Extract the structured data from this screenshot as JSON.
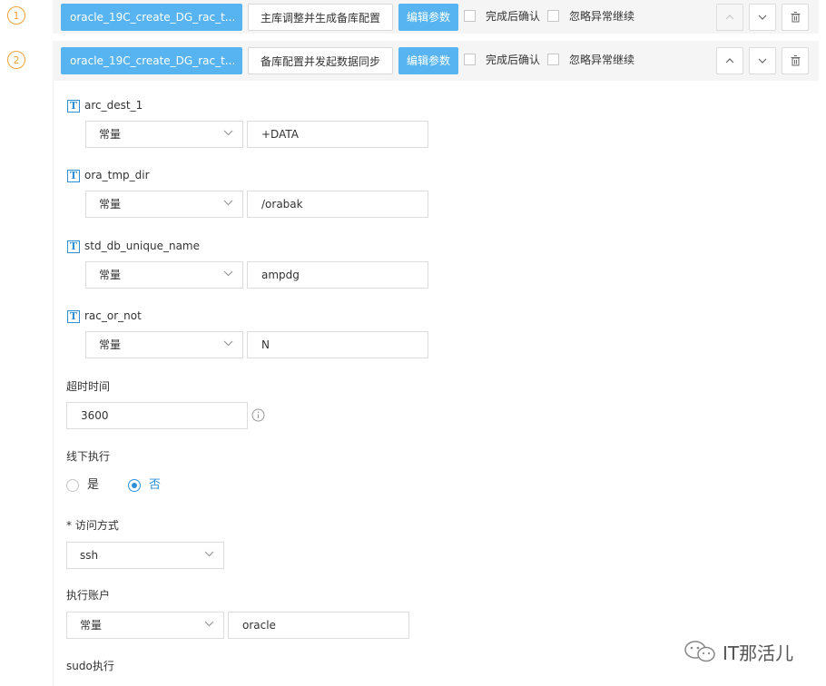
{
  "steps": [
    {
      "number": "1",
      "name": "oracle_19C_create_DG_rac_t...",
      "title": "主库调整并生成备库配置",
      "edit_label": "编辑参数",
      "confirm_label": "完成后确认",
      "ignore_label": "忽略异常继续"
    },
    {
      "number": "2",
      "name": "oracle_19C_create_DG_rac_t...",
      "title": "备库配置并发起数据同步",
      "edit_label": "编辑参数",
      "confirm_label": "完成后确认",
      "ignore_label": "忽略异常继续"
    }
  ],
  "icons": {
    "up": "chevron-up-icon",
    "down": "chevron-down-icon",
    "delete": "trash-icon",
    "param": "text-param-icon",
    "info": "info-icon"
  },
  "params": [
    {
      "name": "arc_dest_1",
      "type": "常量",
      "value": "+DATA"
    },
    {
      "name": "ora_tmp_dir",
      "type": "常量",
      "value": "/orabak"
    },
    {
      "name": "std_db_unique_name",
      "type": "常量",
      "value": "ampdg"
    },
    {
      "name": "rac_or_not",
      "type": "常量",
      "value": "N"
    }
  ],
  "timeout": {
    "label": "超时时间",
    "value": "3600"
  },
  "offline": {
    "label": "线下执行",
    "yes": "是",
    "no": "否",
    "selected": "否"
  },
  "access": {
    "required_mark": "*",
    "label": "访问方式",
    "value": "ssh"
  },
  "exec_account": {
    "label": "执行账户",
    "type": "常量",
    "value": "oracle"
  },
  "sudo": {
    "label": "sudo执行"
  },
  "watermark": "IT那活儿",
  "colors": {
    "primary": "#57b4f0",
    "accent": "#2d8fd8",
    "step_number": "#f0a33a"
  }
}
